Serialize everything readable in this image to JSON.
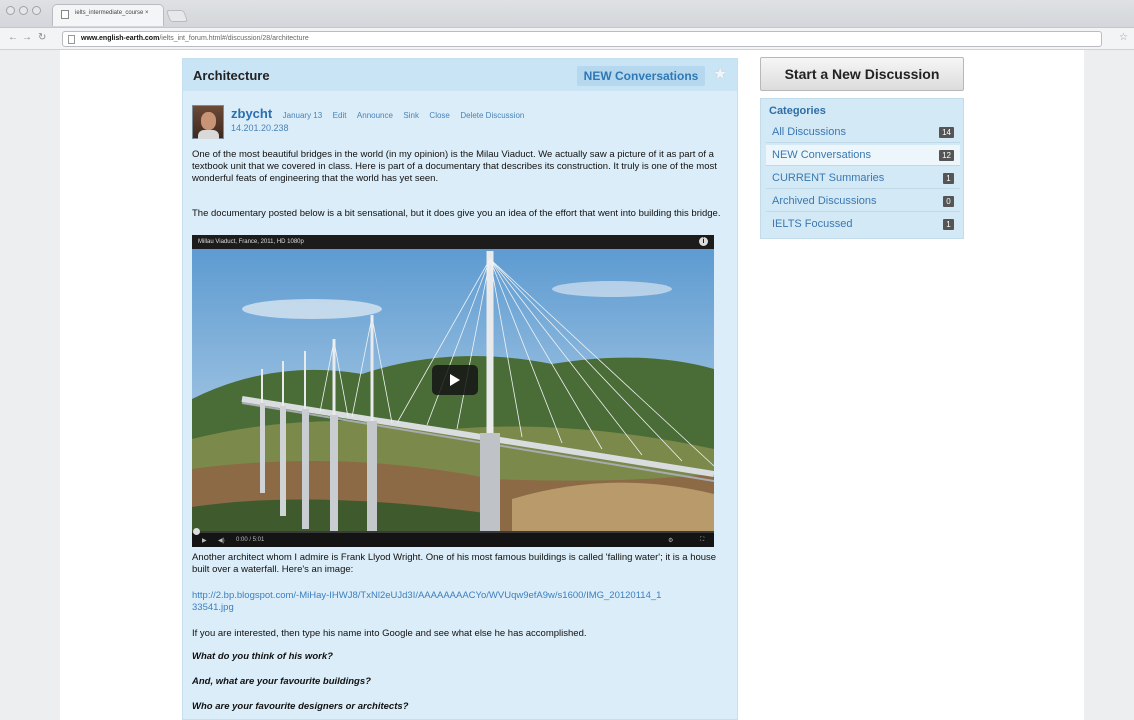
{
  "browser": {
    "tab_title": "ielts_intermediate_course ×",
    "url_domain": "www.english-earth.com",
    "url_path": "/ielts_int_forum.html#/discussion/28/architecture"
  },
  "header": {
    "title": "Architecture",
    "new_conversations_label": "NEW Conversations"
  },
  "post": {
    "author": "zbycht",
    "date": "January 13",
    "actions": [
      "Edit",
      "Announce",
      "Sink",
      "Close",
      "Delete Discussion"
    ],
    "ip": "14.201.20.238",
    "paragraph1": "One of the most beautiful bridges in the world (in my opinion) is the Milau Viaduct. We actually saw a picture of it as part of a textbook unit that we covered in class. Here is part of a documentary that describes its construction. It truly is one of the most wonderful feats of engineering that the world has yet seen.",
    "paragraph2": "The documentary posted below is a bit sensational, but it does give you an idea of the effort that went into building this bridge.",
    "video_title": "Millau Viaduct, France, 2011, HD 1080p",
    "video_time": "0:00 / 5:01",
    "paragraph3": "Another architect whom I admire is Frank Llyod Wright. One of his most famous buildings is called 'falling water'; it is a house built over a waterfall. Here's an image:",
    "link": "http://2.bp.blogspot.com/-MiHay-IHWJ8/TxNl2eUJd3I/AAAAAAAACYo/WVUqw9efA9w/s1600/IMG_20120114_133541.jpg",
    "paragraph4": "If you are interested, then type his name into Google and see what else he has accomplished.",
    "question1": "What do you think of his work?",
    "question2": "And, what are your favourite buildings?",
    "question3": "Who are your favourite designers or architects?"
  },
  "sidebar": {
    "start_button": "Start a New Discussion",
    "categories_title": "Categories",
    "categories": [
      {
        "label": "All Discussions",
        "count": "14"
      },
      {
        "label": "NEW Conversations",
        "count": "12"
      },
      {
        "label": "CURRENT Summaries",
        "count": "1"
      },
      {
        "label": "Archived Discussions",
        "count": "0"
      },
      {
        "label": "IELTS Focussed",
        "count": "1"
      }
    ]
  }
}
